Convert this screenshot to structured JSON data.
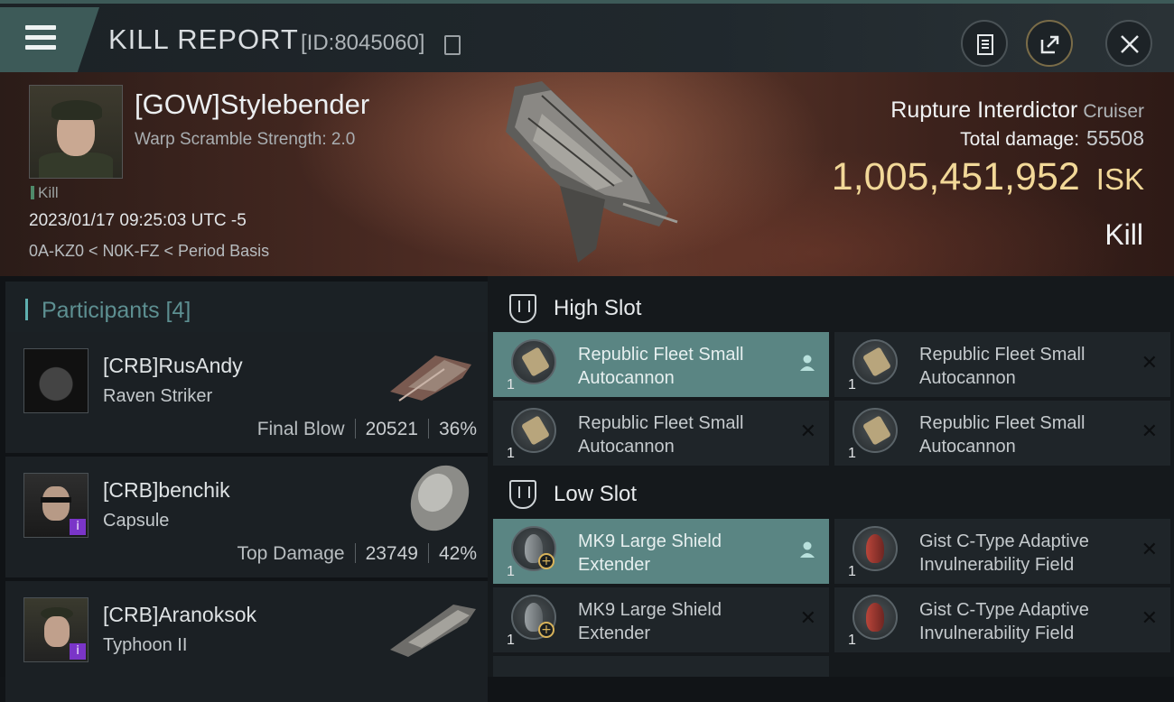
{
  "header": {
    "title": "KILL REPORT",
    "report_id": "[ID:8045060]"
  },
  "victim": {
    "name": "[GOW]Stylebender",
    "attribute": "Warp Scramble Strength: 2.0",
    "tag": "Kill",
    "datetime": "2023/01/17 09:25:03 UTC -5",
    "location": "0A-KZ0 < N0K-FZ < Period Basis",
    "ship_name": "Rupture Interdictor",
    "ship_class": "Cruiser",
    "total_damage_label": "Total damage:",
    "total_damage": "55508",
    "isk_value": "1,005,451,952",
    "isk_unit": "ISK",
    "result": "Kill"
  },
  "participants": {
    "title": "Participants [4]",
    "items": [
      {
        "name": "[CRB]RusAndy",
        "ship": "Raven Striker",
        "label": "Final Blow",
        "damage": "20521",
        "percent": "36%"
      },
      {
        "name": "[CRB]benchik",
        "ship": "Capsule",
        "label": "Top Damage",
        "damage": "23749",
        "percent": "42%"
      },
      {
        "name": "[CRB]Aranoksok",
        "ship": "Typhoon II"
      }
    ]
  },
  "fitting": {
    "high_slot": {
      "title": "High Slot",
      "modules": [
        {
          "name": "Republic Fleet Small Autocannon",
          "qty": "1",
          "status": "dropped"
        },
        {
          "name": "Republic Fleet Small Autocannon",
          "qty": "1",
          "status": "destroyed"
        },
        {
          "name": "Republic Fleet Small Autocannon",
          "qty": "1",
          "status": "destroyed"
        },
        {
          "name": "Republic Fleet Small Autocannon",
          "qty": "1",
          "status": "destroyed"
        }
      ]
    },
    "low_slot": {
      "title": "Low Slot",
      "modules": [
        {
          "name": "MK9 Large Shield Extender",
          "qty": "1",
          "status": "dropped"
        },
        {
          "name": "Gist C-Type Adaptive Invulnerability Field",
          "qty": "1",
          "status": "destroyed"
        },
        {
          "name": "MK9 Large Shield Extender",
          "qty": "1",
          "status": "destroyed"
        },
        {
          "name": "Gist C-Type Adaptive Invulnerability Field",
          "qty": "1",
          "status": "destroyed"
        }
      ]
    }
  },
  "icons": {
    "menu": "hamburger-icon",
    "copy": "copy-icon",
    "report": "clipboard-icon",
    "share": "share-icon",
    "close": "close-icon",
    "dropped": "person-icon",
    "destroyed": "x-icon"
  },
  "colors": {
    "accent": "#5a8583",
    "isk": "#f2d898",
    "hero_bg": "#4a2a22"
  }
}
